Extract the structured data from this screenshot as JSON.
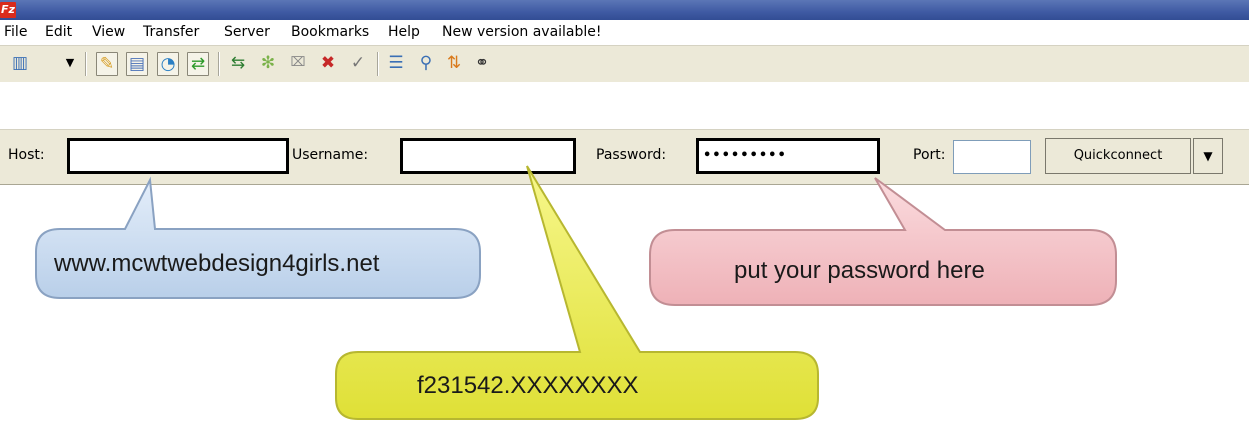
{
  "window": {
    "icon_text": "Fz"
  },
  "menu": {
    "items": [
      "File",
      "Edit",
      "View",
      "Transfer",
      "Server",
      "Bookmarks",
      "Help",
      "New version available!"
    ]
  },
  "toolbar": {
    "icons": [
      "site-manager-icon",
      "dropdown-arrow-icon",
      "message-log-icon",
      "local-tree-icon",
      "remote-tree-icon",
      "transfer-queue-icon",
      "refresh-icon",
      "process-queue-icon",
      "cancel-icon",
      "disconnect-icon",
      "reconnect-icon",
      "filter-icon",
      "compare-icon",
      "sync-browse-icon",
      "search-icon"
    ]
  },
  "quickconnect": {
    "host_label": "Host:",
    "host_value": "",
    "username_label": "Username:",
    "username_value": "",
    "password_label": "Password:",
    "password_value": "•••••••••",
    "port_label": "Port:",
    "port_value": "",
    "quickconnect_label": "Quickconnect"
  },
  "callouts": {
    "host_hint": "www.mcwtwebdesign4girls.net",
    "username_hint": "f231542.XXXXXXXX",
    "password_hint": "put your password here"
  },
  "colors": {
    "titlebar": "#3f5aa3",
    "host_callout": "#cfe0f3",
    "username_callout": "#eef060",
    "password_callout": "#f3c4c8"
  }
}
